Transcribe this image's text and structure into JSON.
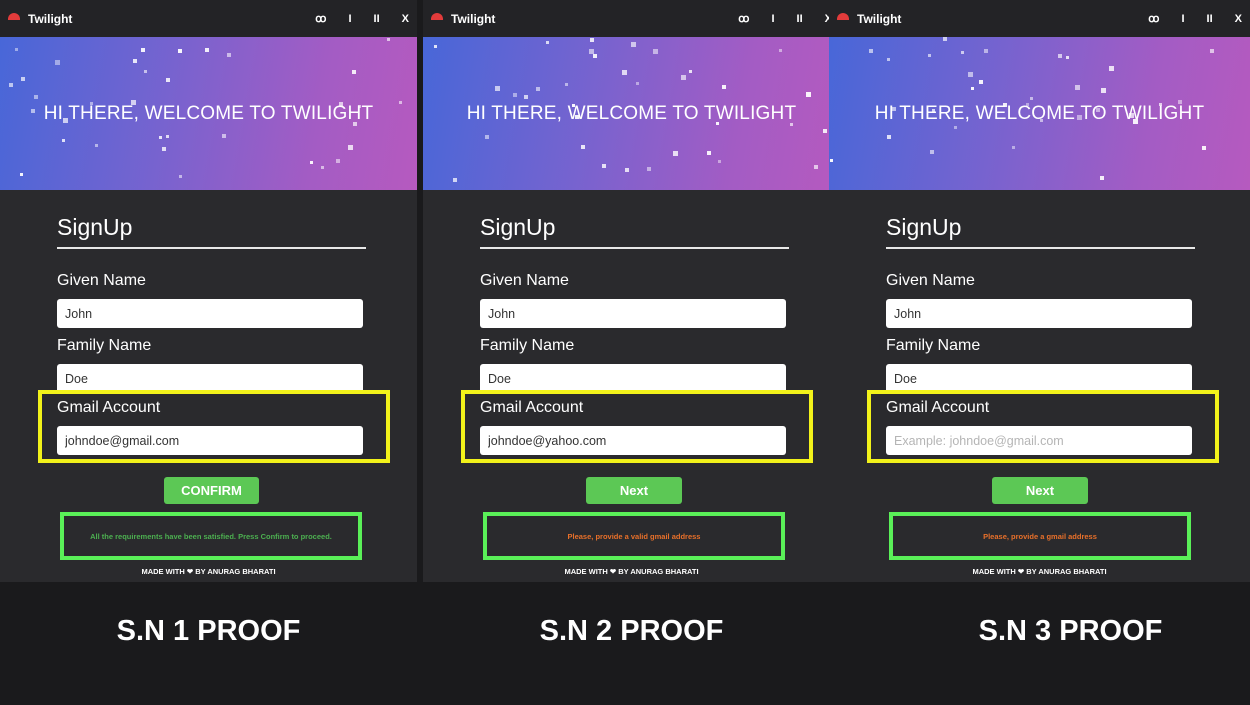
{
  "panels": [
    {
      "title": "Twilight",
      "controls": [
        "ꝏ",
        "I",
        "II",
        "X"
      ],
      "welcome": "HI THERE, WELCOME TO TWILIGHT",
      "heading": "SignUp",
      "given_label": "Given Name",
      "given_value": "John",
      "family_label": "Family Name",
      "family_value": "Doe",
      "gmail_label": "Gmail Account",
      "gmail_value": "johndoe@gmail.com",
      "gmail_placeholder": "",
      "button_label": "CONFIRM",
      "message": "All the requirements have been satisfied. Press Confirm to proceed.",
      "message_color": "#4caf50",
      "footer": "MADE WITH ❤ BY ANURAG BHARATI",
      "caption": "S.N 1 PROOF"
    },
    {
      "title": "Twilight",
      "controls": [
        "ꝏ",
        "I",
        "II",
        "X"
      ],
      "welcome": "HI THERE, WELCOME TO TWILIGHT",
      "heading": "SignUp",
      "given_label": "Given Name",
      "given_value": "John",
      "family_label": "Family Name",
      "family_value": "Doe",
      "gmail_label": "Gmail Account",
      "gmail_value": "johndoe@yahoo.com",
      "gmail_placeholder": "",
      "button_label": "Next",
      "message": "Please, provide a valid gmail address",
      "message_color": "#e8702a",
      "footer": "MADE WITH ❤ BY ANURAG BHARATI",
      "caption": "S.N 2 PROOF"
    },
    {
      "title": "Twilight",
      "controls": [
        "ꝏ",
        "I",
        "II",
        "X"
      ],
      "welcome": "HI THERE, WELCOME TO TWILIGHT",
      "heading": "SignUp",
      "given_label": "Given Name",
      "given_value": "John",
      "family_label": "Family Name",
      "family_value": "Doe",
      "gmail_label": "Gmail Account",
      "gmail_value": "",
      "gmail_placeholder": "Example: johndoe@gmail.com",
      "button_label": "Next",
      "message": "Please, provide a gmail address",
      "message_color": "#e8702a",
      "footer": "MADE WITH ❤ BY ANURAG BHARATI",
      "caption": "S.N 3 PROOF"
    }
  ],
  "colors": {
    "hero_gradient_start": "#4867d8",
    "hero_gradient_end": "#b65abf",
    "highlight_yellow": "#f2f21a",
    "highlight_green": "#5af058",
    "button_green": "#5cc855"
  }
}
